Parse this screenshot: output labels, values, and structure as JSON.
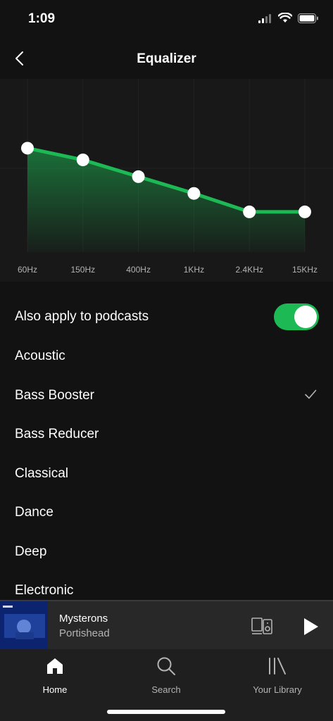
{
  "status_bar": {
    "time": "1:09"
  },
  "header": {
    "title": "Equalizer"
  },
  "equalizer": {
    "bands": [
      {
        "label": "60Hz",
        "gain": 0.62
      },
      {
        "label": "150Hz",
        "gain": 0.55
      },
      {
        "label": "400Hz",
        "gain": 0.45
      },
      {
        "label": "1KHz",
        "gain": 0.35
      },
      {
        "label": "2.4KHz",
        "gain": 0.24
      },
      {
        "label": "15KHz",
        "gain": 0.24
      }
    ],
    "accent_color": "#1DB954"
  },
  "podcast_toggle": {
    "label": "Also apply to podcasts",
    "on": true
  },
  "presets": [
    {
      "label": "Acoustic",
      "selected": false
    },
    {
      "label": "Bass Booster",
      "selected": true
    },
    {
      "label": "Bass Reducer",
      "selected": false
    },
    {
      "label": "Classical",
      "selected": false
    },
    {
      "label": "Dance",
      "selected": false
    },
    {
      "label": "Deep",
      "selected": false
    },
    {
      "label": "Electronic",
      "selected": false
    }
  ],
  "now_playing": {
    "title": "Mysterons",
    "artist": "Portishead"
  },
  "tabs": [
    {
      "label": "Home",
      "icon": "home-icon",
      "active": true
    },
    {
      "label": "Search",
      "icon": "search-icon",
      "active": false
    },
    {
      "label": "Your Library",
      "icon": "library-icon",
      "active": false
    }
  ]
}
